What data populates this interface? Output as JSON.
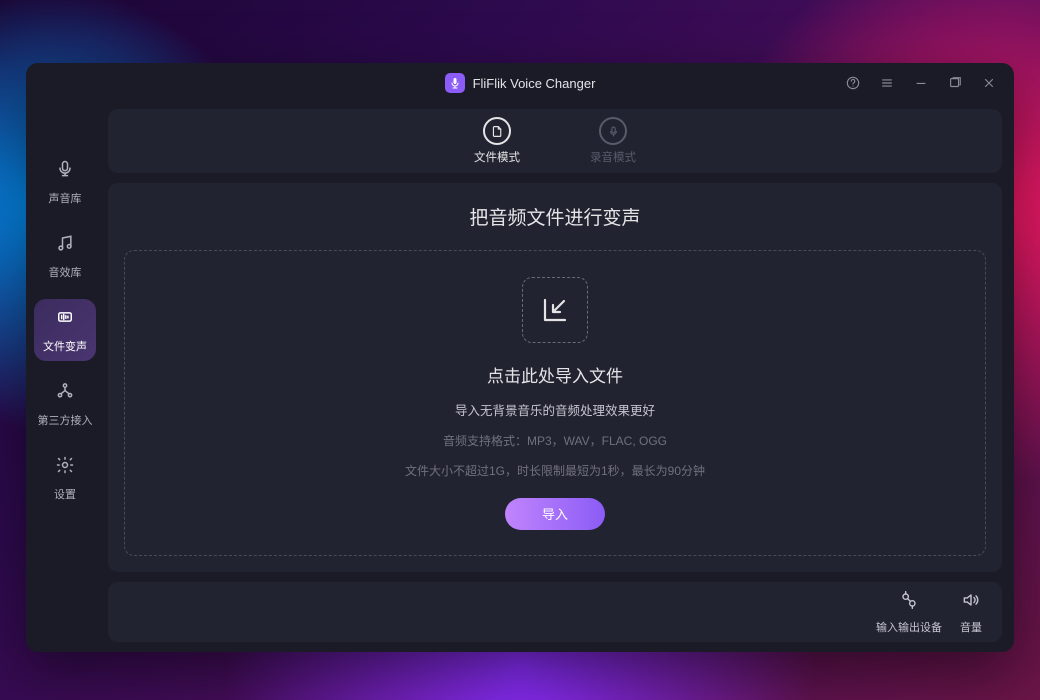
{
  "app": {
    "title": "FliFlik Voice Changer"
  },
  "window_controls": {
    "help": "help",
    "menu": "menu",
    "minimize": "minimize",
    "maximize": "maximize",
    "close": "close"
  },
  "sidebar": {
    "items": [
      {
        "label": "声音库",
        "icon": "microphone"
      },
      {
        "label": "音效库",
        "icon": "music-note"
      },
      {
        "label": "文件变声",
        "icon": "file-audio"
      },
      {
        "label": "第三方接入",
        "icon": "integration"
      },
      {
        "label": "设置",
        "icon": "gear"
      }
    ],
    "active_index": 2
  },
  "tabs": {
    "items": [
      {
        "label": "文件模式",
        "icon": "file"
      },
      {
        "label": "录音模式",
        "icon": "microphone"
      }
    ],
    "active_index": 0
  },
  "content": {
    "headline": "把音频文件进行变声",
    "drop": {
      "title": "点击此处导入文件",
      "subtitle": "导入无背景音乐的音频处理效果更好",
      "format_hint": "音频支持格式：MP3，WAV，FLAC, OGG",
      "size_hint": "文件大小不超过1G，时长限制最短为1秒，最长为90分钟",
      "import_button": "导入"
    }
  },
  "footer": {
    "io_devices": "输入输出设备",
    "volume": "音量"
  }
}
